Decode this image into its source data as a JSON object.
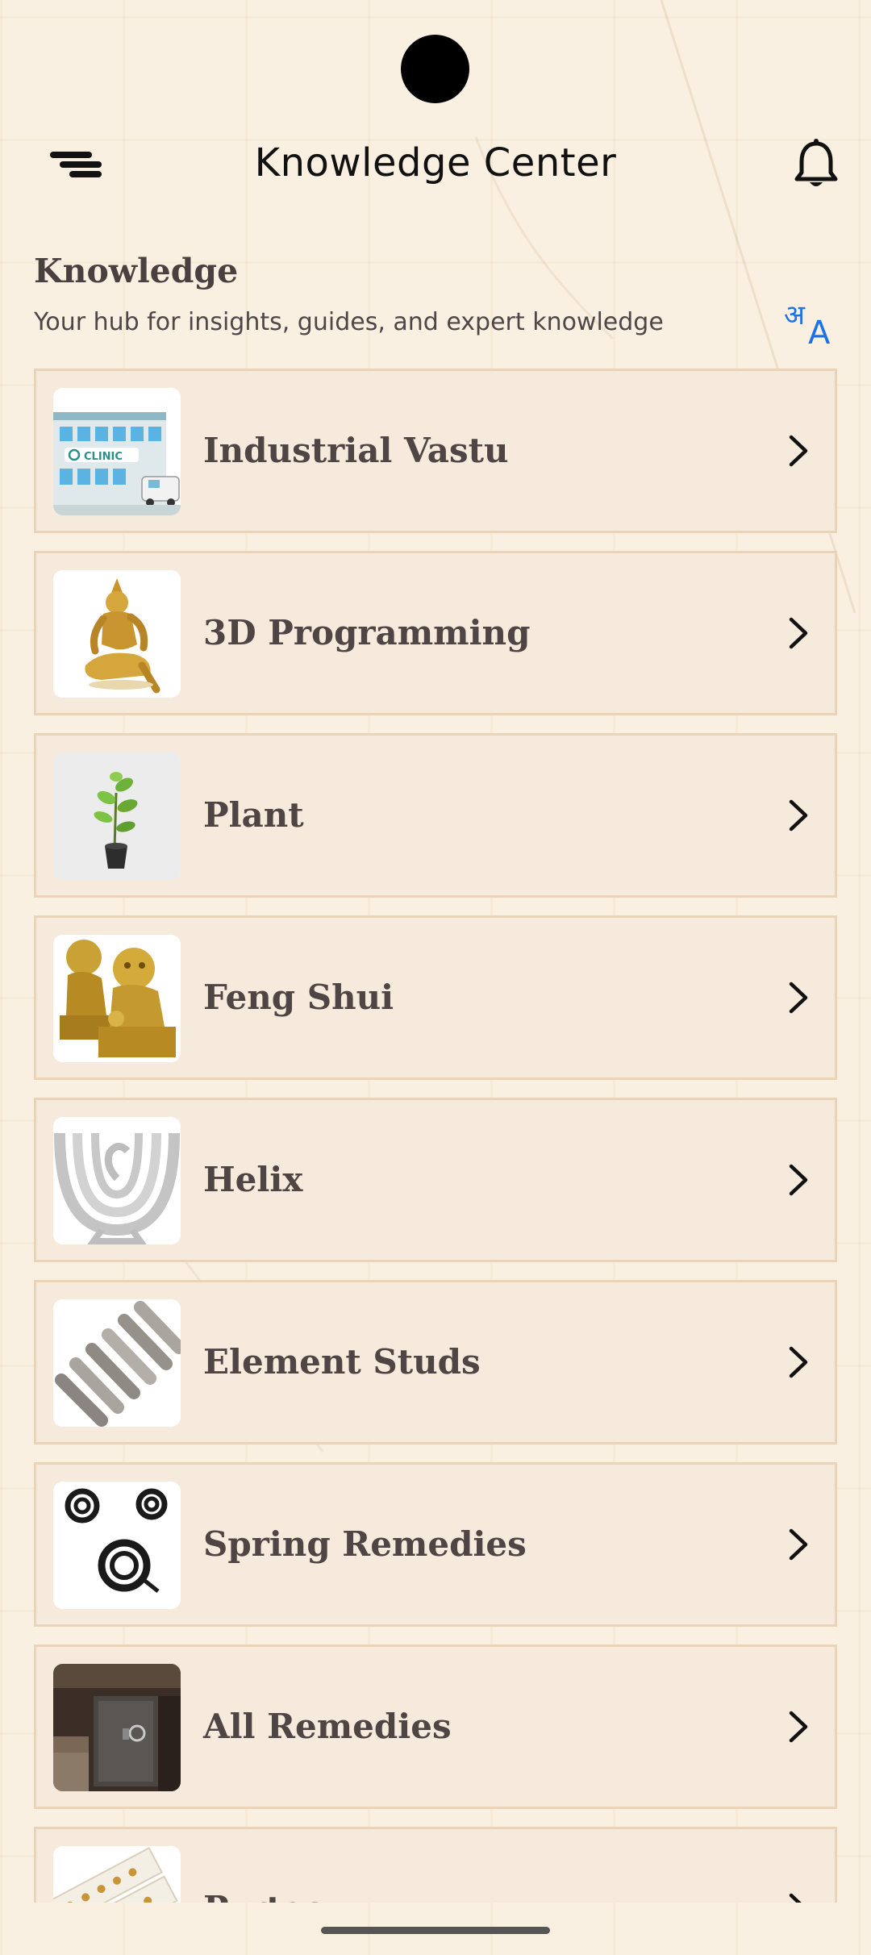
{
  "app_bar": {
    "title": "Knowledge Center",
    "menu_icon": "menu-icon",
    "notification_icon": "bell-icon"
  },
  "section": {
    "heading": "Knowledge",
    "subtitle": "Your hub for insights, guides, and expert knowledge",
    "translate_icon": "translate-icon",
    "translate_color": "#1a73e8"
  },
  "knowledge_items": [
    {
      "label": "Industrial Vastu",
      "thumb": "clinic-building"
    },
    {
      "label": "3D Programming",
      "thumb": "golden-deity-statue"
    },
    {
      "label": "Plant",
      "thumb": "potted-plant"
    },
    {
      "label": "Feng Shui",
      "thumb": "golden-fu-lions"
    },
    {
      "label": "Helix",
      "thumb": "silver-helix-symbol"
    },
    {
      "label": "Element Studs",
      "thumb": "metal-studs"
    },
    {
      "label": "Spring Remedies",
      "thumb": "black-springs"
    },
    {
      "label": "All Remedies",
      "thumb": "safe-locker"
    },
    {
      "label": "Pyrtec",
      "thumb": "pyramid-strips"
    }
  ],
  "colors": {
    "background": "#faf0e2",
    "card_background": "#f5eadb",
    "card_border": "#ead3b6",
    "text": "#4f4545"
  }
}
